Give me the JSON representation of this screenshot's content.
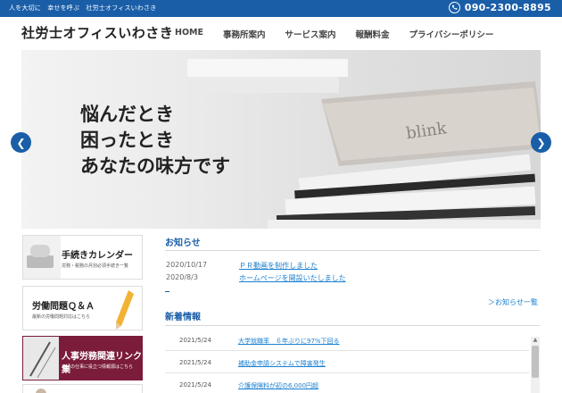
{
  "topbar": {
    "tagline": "人を大切に　幸せを呼ぶ　社労士オフィスいわさき",
    "phone": "090-2300-8895"
  },
  "header": {
    "logo": "社労士オフィスいわさき",
    "nav": [
      "HOME",
      "事務所案内",
      "サービス案内",
      "報酬料金",
      "プライバシーポリシー"
    ]
  },
  "hero": {
    "lines": [
      "悩んだとき",
      "困ったとき",
      "あなたの味方です"
    ],
    "book_text": "blink"
  },
  "sidebar": {
    "banners": [
      {
        "title": "手続きカレンダー",
        "sub": "労務・税務の月別必須手続き一覧"
      },
      {
        "title": "労働問題Ｑ＆Ａ",
        "sub": "最新の労働問題対応はこちら"
      },
      {
        "title": "人事労務関連リンク集",
        "sub": "日頃の仕事に役立つ情報源はこちら"
      }
    ]
  },
  "notices": {
    "title": "お知らせ",
    "items": [
      {
        "date": "2020/10/17",
        "text": "ＰＲ動画を制作しました"
      },
      {
        "date": "2020/8/3",
        "text": "ホームページを開設いたしました"
      }
    ],
    "more": "＞お知らせ一覧"
  },
  "latest": {
    "title": "新着情報",
    "items": [
      {
        "date": "2021/5/24",
        "text": "大学就職率　６年ぶりに97%下回る"
      },
      {
        "date": "2021/5/24",
        "text": "補助金申請システムで障害発生"
      },
      {
        "date": "2021/5/24",
        "text": "介護保険料が初の6,000円超"
      }
    ]
  }
}
